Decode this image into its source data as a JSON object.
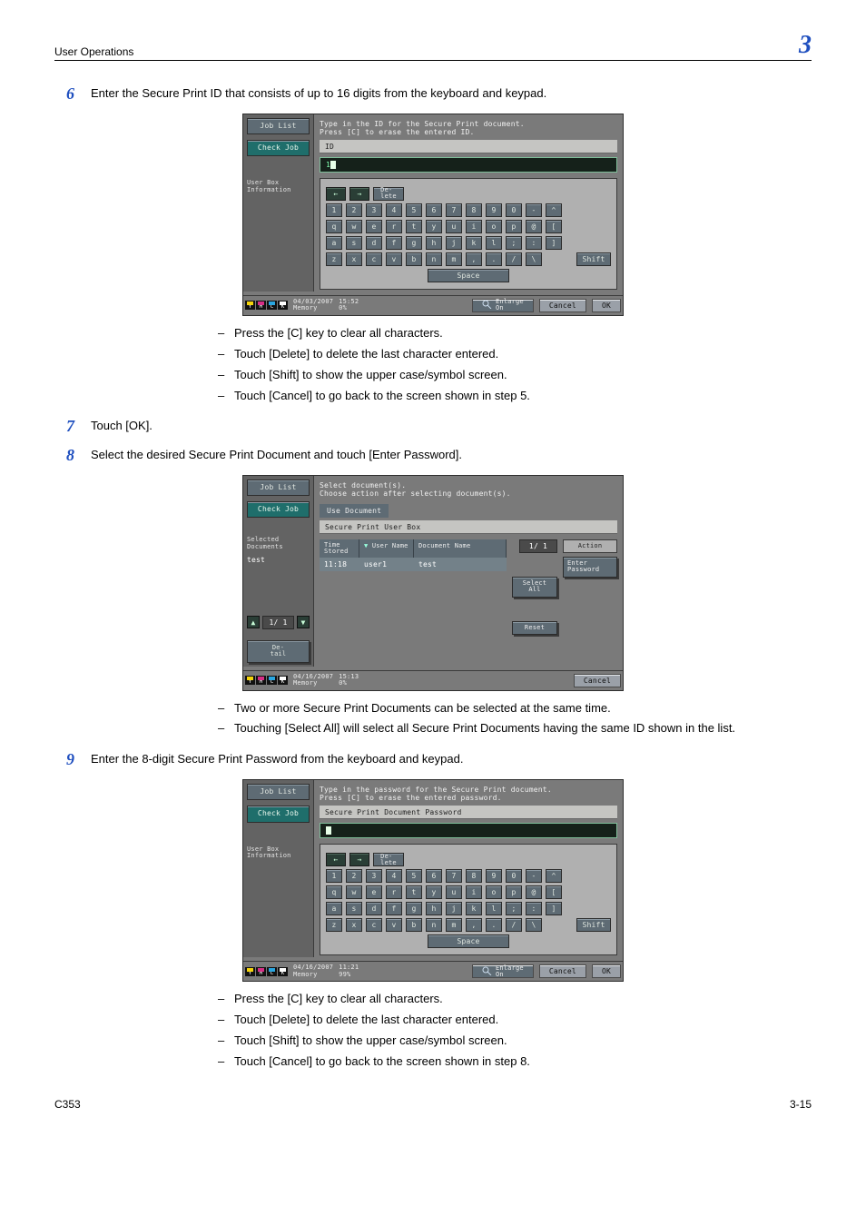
{
  "header": {
    "section": "User Operations",
    "chapter": "3"
  },
  "footer": {
    "model": "C353",
    "page": "3-15"
  },
  "s6": {
    "text": "Enter the Secure Print ID that consists of up to 16 digits from the keyboard and keypad.",
    "bullets": [
      "Press the [C] key to clear all characters.",
      "Touch [Delete] to delete the last character entered.",
      "Touch [Shift] to show the upper case/symbol screen.",
      "Touch [Cancel] to go back to the screen shown in step 5."
    ]
  },
  "s7": {
    "text": "Touch [OK]."
  },
  "s8": {
    "text": "Select the desired Secure Print Document and touch [Enter Password].",
    "bullets": [
      "Two or more Secure Print Documents can be selected at the same time.",
      "Touching [Select All] will select all Secure Print Documents having the same ID shown in the list."
    ]
  },
  "s9": {
    "text": "Enter the 8-digit Secure Print Password from the keyboard and keypad.",
    "bullets": [
      "Press the [C] key to clear all characters.",
      "Touch [Delete] to delete the last character entered.",
      "Touch [Shift] to show the upper case/symbol screen.",
      "Touch [Cancel] to go back to the screen shown in step 8."
    ]
  },
  "kb": {
    "delete": "De-\nlete",
    "row1": [
      "1",
      "2",
      "3",
      "4",
      "5",
      "6",
      "7",
      "8",
      "9",
      "0",
      "-",
      "^"
    ],
    "row2": [
      "q",
      "w",
      "e",
      "r",
      "t",
      "y",
      "u",
      "i",
      "o",
      "p",
      "@",
      "["
    ],
    "row3": [
      "a",
      "s",
      "d",
      "f",
      "g",
      "h",
      "j",
      "k",
      "l",
      ";",
      ":",
      "]"
    ],
    "row4": [
      "z",
      "x",
      "c",
      "v",
      "b",
      "n",
      "m",
      ",",
      ".",
      "/",
      "\\"
    ],
    "shift": "Shift",
    "space": "Space"
  },
  "p1": {
    "side": {
      "jobList": "Job List",
      "checkJob": "Check Job",
      "userBox": "User Box\nInformation"
    },
    "instr": "Type in the ID for the Secure Print document.\nPress [C] to erase the entered ID.",
    "barTitle": "ID",
    "input": "1",
    "status": {
      "date": "04/03/2007",
      "time": "15:52",
      "memLabel": "Memory",
      "memVal": "0%",
      "enlarge": "Enlarge\nOn",
      "cancel": "Cancel",
      "ok": "OK"
    }
  },
  "p2": {
    "side": {
      "jobList": "Job List",
      "checkJob": "Check Job",
      "selDocsLabel": "Selected Documents",
      "selDocsVal": "test",
      "page": "1/  1",
      "detail": "De-\ntail"
    },
    "instr": "Select document(s).\nChoose action after selecting document(s).",
    "tab": "Use Document",
    "crumb": "Secure Print User Box",
    "cols": {
      "time": "Time\nStored",
      "user": "User Name",
      "doc": "Document Name"
    },
    "row": {
      "time": "11:18",
      "user": "user1",
      "doc": "test"
    },
    "page": "1/  1",
    "actionLabel": "Action",
    "enterPw": "Enter\nPassword",
    "selectAll": "Select\nAll",
    "reset": "Reset",
    "status": {
      "date": "04/16/2007",
      "time": "15:13",
      "memLabel": "Memory",
      "memVal": "0%",
      "cancel": "Cancel"
    }
  },
  "p3": {
    "side": {
      "jobList": "Job List",
      "checkJob": "Check Job",
      "userBox": "User Box\nInformation"
    },
    "instr": "Type in the password for the Secure Print document.\nPress [C] to erase the entered password.",
    "barTitle": "Secure Print Document Password",
    "status": {
      "date": "04/16/2007",
      "time": "11:21",
      "memLabel": "Memory",
      "memVal": "99%",
      "enlarge": "Enlarge\nOn",
      "cancel": "Cancel",
      "ok": "OK"
    }
  },
  "toner": [
    {
      "l": "Y",
      "c": "#f5d40a"
    },
    {
      "l": "M",
      "c": "#d62e86"
    },
    {
      "l": "C",
      "c": "#2aa6e0"
    },
    {
      "l": "K",
      "c": "#ffffff"
    }
  ]
}
